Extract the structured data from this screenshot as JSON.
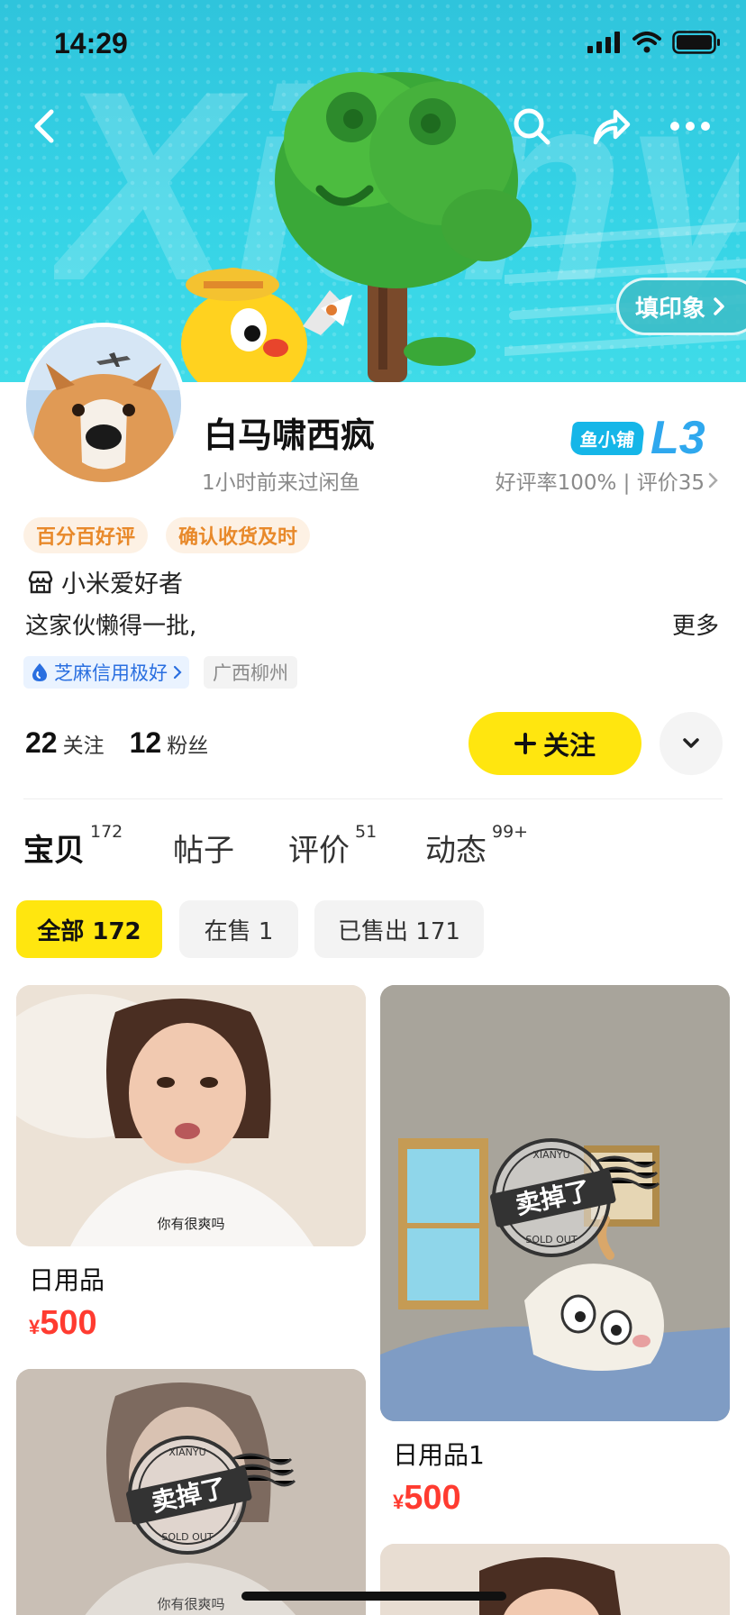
{
  "status_bar": {
    "time": "14:29"
  },
  "banner": {
    "watermark": "Xianyu",
    "fill_impression_label": "填印象"
  },
  "profile": {
    "username": "白马啸西疯",
    "last_seen": "1小时前来过闲鱼",
    "shop_tag": "鱼小铺",
    "level": "L3",
    "rating_text": "好评率100% | 评价35",
    "tags": [
      "百分百好评",
      "确认收货及时"
    ],
    "shop_name": "小米爱好者",
    "bio": "这家伙懒得一批,",
    "more_label": "更多",
    "credit": "芝麻信用极好",
    "location": "广西柳州",
    "following_count": "22",
    "following_label": "关注",
    "followers_count": "12",
    "followers_label": "粉丝",
    "follow_button": "关注"
  },
  "tabs": [
    {
      "label": "宝贝",
      "badge": "172"
    },
    {
      "label": "帖子",
      "badge": ""
    },
    {
      "label": "评价",
      "badge": "51"
    },
    {
      "label": "动态",
      "badge": "99+"
    }
  ],
  "filters": [
    "全部 172",
    "在售 1",
    "已售出 171"
  ],
  "products": [
    {
      "title": "日用品",
      "currency": "¥",
      "price": "500",
      "caption": "你有很爽吗",
      "sold": false
    },
    {
      "title": "日用品1",
      "currency": "¥",
      "price": "500",
      "sold": true
    },
    {
      "caption": "你有很爽吗",
      "sold": true
    }
  ],
  "sold_stamp": {
    "brand": "XIANYU",
    "text": "卖掉了",
    "sub": "SOLD OUT"
  },
  "colors": {
    "accent_yellow": "#ffe60f",
    "banner_cyan": "#35d3e6",
    "price_red": "#ff3b30",
    "tag_orange": "#e8892a"
  }
}
